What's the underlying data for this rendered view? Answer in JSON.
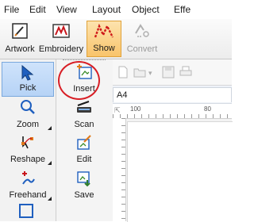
{
  "menubar": {
    "items": [
      "File",
      "Edit",
      "View",
      "Layout",
      "Object",
      "Effe"
    ]
  },
  "toolbar": {
    "artwork": "Artwork",
    "embroidery": "Embroidery",
    "show": "Show",
    "convert": "Convert"
  },
  "left_tools": {
    "pick": "Pick",
    "zoom": "Zoom",
    "reshape": "Reshape",
    "freehand": "Freehand"
  },
  "image_tools": {
    "insert": "Insert",
    "scan": "Scan",
    "edit": "Edit",
    "save": "Save"
  },
  "document_tab": {
    "label": "A4"
  },
  "ruler": {
    "top_labels": [
      "100",
      "80"
    ]
  },
  "colors": {
    "highlight": "#d81e25",
    "active_tool_bg": "#f9c46b",
    "selected_tool_bg": "#b6d3f6"
  }
}
